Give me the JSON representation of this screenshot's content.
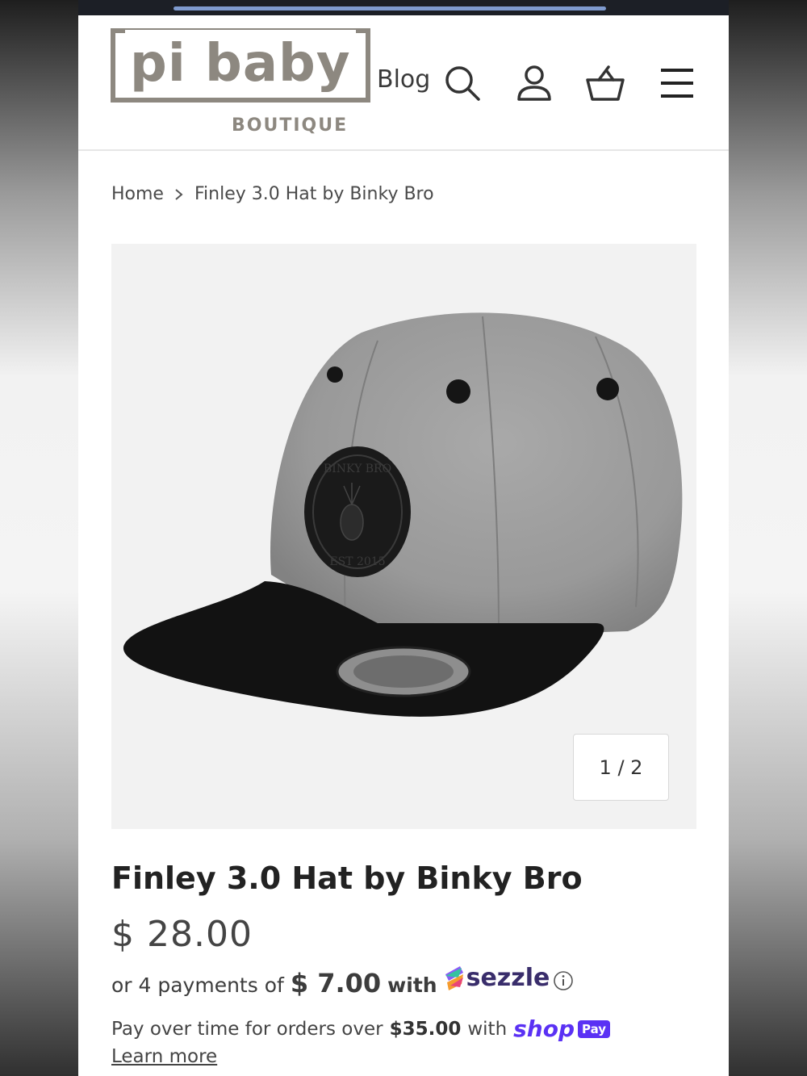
{
  "brand": {
    "logo_text": "pi baby",
    "logo_sub": "BOUTIQUE"
  },
  "nav": {
    "blog_label": "Blog",
    "icons": [
      "search-icon",
      "account-icon",
      "cart-icon",
      "menu-icon"
    ]
  },
  "breadcrumb": {
    "home": "Home",
    "current": "Finley 3.0 Hat by Binky Bro"
  },
  "product": {
    "title": "Finley 3.0 Hat by Binky Bro",
    "price": "$ 28.00",
    "image_counter": "1 / 2",
    "patch_top_text": "BINKY BRO",
    "patch_bottom_text": "EST 2015"
  },
  "sezzle": {
    "prefix": "or 4 payments of",
    "amount": "$ 7.00",
    "with": "with",
    "brand": "sezzle"
  },
  "shoppay": {
    "text": "Pay over time for orders over",
    "threshold": "$35.00",
    "with": "with",
    "shop": "shop",
    "pay": "Pay",
    "learn_more": "Learn more"
  },
  "colors": {
    "logo": "#8d8880",
    "shoppay": "#5a31f4",
    "sezzle": "#392d6b"
  }
}
